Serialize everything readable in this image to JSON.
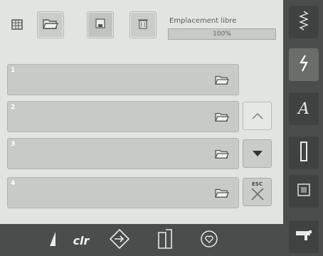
{
  "toolbar": {
    "icons": [
      "memory-icon",
      "open-folder-icon",
      "save-icon",
      "delete-icon"
    ]
  },
  "free_space": {
    "label": "Emplacement libre",
    "percent_text": "100%",
    "fraction": 1.0
  },
  "slots": [
    {
      "number": "1"
    },
    {
      "number": "2"
    },
    {
      "number": "3"
    },
    {
      "number": "4"
    }
  ],
  "esc": {
    "label": "ESC"
  },
  "right_menu": {
    "icons": [
      "utility-stitch-icon",
      "decorative-stitch-icon",
      "alphabet-icon",
      "buttonhole-icon",
      "quilt-stitch-icon",
      "setup-icon"
    ],
    "alphabet_glyph": "A"
  },
  "bottom_menu": {
    "clr_label": "clr",
    "icons": [
      "needle-stop-icon",
      "clr-icon",
      "pattern-start-icon",
      "mirror-icon",
      "favorites-heart-icon"
    ]
  }
}
